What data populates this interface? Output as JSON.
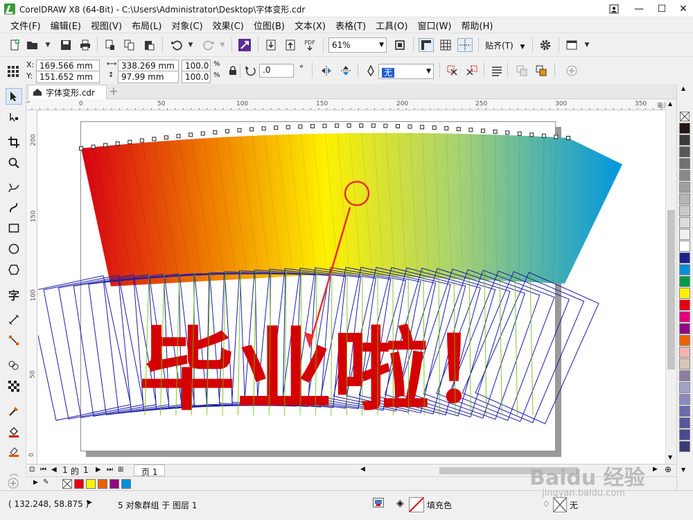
{
  "window": {
    "title": "CorelDRAW X8 (64-Bit) - C:\\Users\\Administrator\\Desktop\\字体变形.cdr",
    "min_glyph": "—",
    "max_glyph": "☐",
    "close_glyph": "✕"
  },
  "menu": [
    "文件(F)",
    "编辑(E)",
    "视图(V)",
    "布局(L)",
    "对象(C)",
    "效果(C)",
    "位图(B)",
    "文本(X)",
    "表格(T)",
    "工具(O)",
    "窗口(W)",
    "帮助(H)"
  ],
  "toolbar": {
    "zoom": "61%",
    "pdf_label": "PDF",
    "snap_label": "贴齐(T)"
  },
  "props": {
    "x_label": "X:",
    "x": "169.566 mm",
    "y_label": "Y:",
    "y": "151.652 mm",
    "width": "338.269 mm",
    "height": "97.99 mm",
    "scale_x": "100.0",
    "scale_y": "100.0",
    "pct": "%",
    "rotation": ".0",
    "degree": "°",
    "outline": "无"
  },
  "doc_tab": {
    "name": "字体变形.cdr"
  },
  "ruler": {
    "top_ticks": [
      "0",
      "50",
      "100",
      "150",
      "200",
      "250",
      "300",
      "350"
    ],
    "top_unit": "毫米",
    "left_ticks": [
      "200",
      "150",
      "100",
      "50",
      "0"
    ]
  },
  "artwork": {
    "text": "毕业啦！",
    "gradient_colors": [
      "#d60012",
      "#f08200",
      "#fff000",
      "#a6d174",
      "#0096e0"
    ],
    "text_color": "#d40000",
    "outline_color": "#1a1aa8",
    "guide_color": "#6cc000",
    "annotation_color": "#e83030"
  },
  "palette_colors": [
    "#231815",
    "#3e3a39",
    "#595757",
    "#727171",
    "#898989",
    "#9fa0a0",
    "#b5b5b6",
    "#c9caca",
    "#dcdddd",
    "#efefef",
    "#ffffff",
    "#1d2088",
    "#0091db",
    "#009944",
    "#fff100",
    "#e60012",
    "#e4007f",
    "#920783",
    "#eb6100",
    "#f5b2b2",
    "#d8c7b3",
    "#8d7e9f",
    "#a3a1cc",
    "#8c89c1",
    "#6e6aae",
    "#58589e",
    "#4c4a8e",
    "#3d3a78"
  ],
  "page_nav": {
    "current": "1",
    "of_label": "的",
    "total": "1",
    "page_tab": "页 1"
  },
  "doc_palette": [
    "#ffffff",
    "#e60012",
    "#fff100",
    "#eb6100",
    "#920783",
    "#0091db"
  ],
  "status": {
    "coords": "( 132.248, 58.875 )",
    "selection": "5 对象群组 于 图层 1",
    "fill_label": "填充色",
    "outline_label": "无"
  },
  "watermark": {
    "line1": "Baidu 经验",
    "line2": "jingyan.baidu.com"
  }
}
